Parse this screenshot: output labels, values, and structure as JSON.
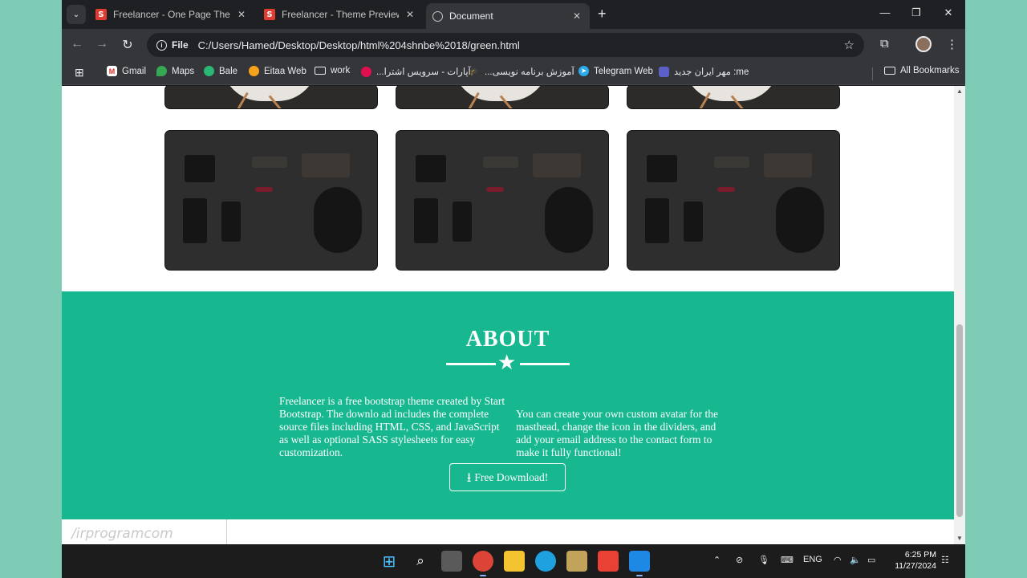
{
  "browser": {
    "tabs": [
      {
        "title": "Freelancer - One Page Theme -",
        "favicon": "S",
        "active": false
      },
      {
        "title": "Freelancer - Theme Preview - S",
        "favicon": "S",
        "active": false
      },
      {
        "title": "Document",
        "favicon": "globe-icon",
        "active": true
      }
    ],
    "address": {
      "chip": "File",
      "url": "C:/Users/Hamed/Desktop/Desktop/html%204shnbe%2018/green.html"
    },
    "bookmarks": [
      "Gmail",
      "Maps",
      "Bale",
      "Eitaa Web",
      "work",
      "...آپارات - سرویس اشترا",
      "...آموزش برنامه نویسی",
      "Telegram Web",
      "مهر ایران جدید :me"
    ],
    "all_bookmarks": "All Bookmarks"
  },
  "page": {
    "about": {
      "title": "ABOUT",
      "left_text": "Freelancer is a free bootstrap theme created by Start Bootstrap. The downlo ad includes the complete source files including HTML, CSS, and JavaScript as well as optional SASS stylesheets for easy customization.",
      "right_text": "You can create your own custom avatar for the masthead, change the icon in the dividers, and add your email address to the contact form to make it fully functional!",
      "button": "Free Dowmload!"
    },
    "watermark": "/irprogramcom",
    "accent_color": "#17b890"
  },
  "taskbar": {
    "language": "ENG",
    "time": "6:25 PM",
    "date": "11/27/2024"
  }
}
